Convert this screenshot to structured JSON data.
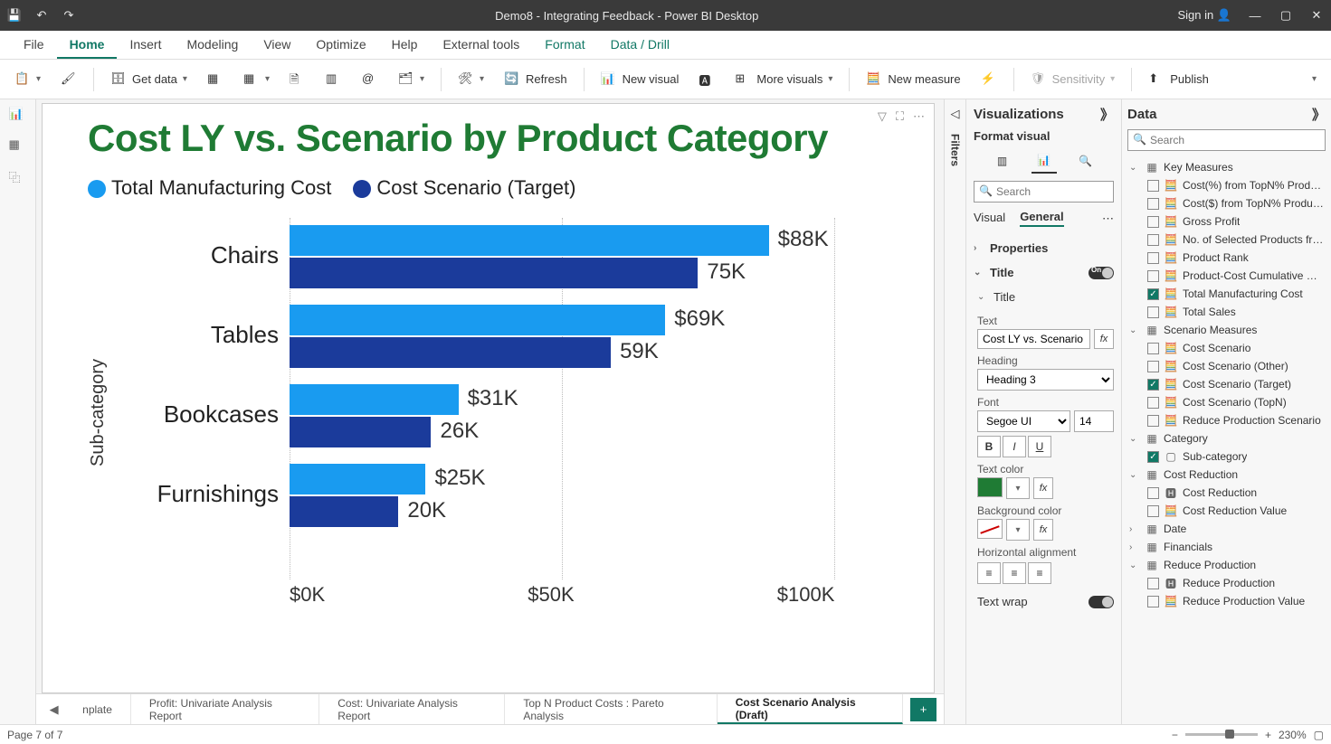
{
  "titlebar": {
    "title": "Demo8 - Integrating Feedback - Power BI Desktop",
    "signin": "Sign in"
  },
  "menu": [
    "File",
    "Home",
    "Insert",
    "Modeling",
    "View",
    "Optimize",
    "Help",
    "External tools",
    "Format",
    "Data / Drill"
  ],
  "ribbon": {
    "getdata": "Get data",
    "refresh": "Refresh",
    "newvisual": "New visual",
    "morevisuals": "More visuals",
    "newmeasure": "New measure",
    "sensitivity": "Sensitivity",
    "publish": "Publish"
  },
  "filters_label": "Filters",
  "viz": {
    "title": "Visualizations",
    "sub": "Format visual",
    "search_ph": "Search",
    "tabs": {
      "visual": "Visual",
      "general": "General"
    },
    "properties": "Properties",
    "title_section": "Title",
    "form": {
      "title": "Title",
      "text_lbl": "Text",
      "text_val": "Cost LY vs. Scenario",
      "heading_lbl": "Heading",
      "heading_val": "Heading 3",
      "font_lbl": "Font",
      "font_val": "Segoe UI",
      "font_size": "14",
      "textcolor_lbl": "Text color",
      "bgcolor_lbl": "Background color",
      "halign_lbl": "Horizontal alignment",
      "wrap_lbl": "Text wrap"
    }
  },
  "data": {
    "title": "Data",
    "search_ph": "Search",
    "tables": [
      {
        "name": "Key Measures",
        "fields": [
          {
            "n": "Cost(%) from TopN% Products",
            "c": false,
            "i": "calc"
          },
          {
            "n": "Cost($) from TopN% Products",
            "c": false,
            "i": "calc"
          },
          {
            "n": "Gross Profit",
            "c": false,
            "i": "calc"
          },
          {
            "n": "No. of Selected Products fro…",
            "c": false,
            "i": "calc"
          },
          {
            "n": "Product Rank",
            "c": false,
            "i": "calc"
          },
          {
            "n": "Product-Cost Cumulative Per…",
            "c": false,
            "i": "calc"
          },
          {
            "n": "Total Manufacturing Cost",
            "c": true,
            "i": "calc"
          },
          {
            "n": "Total Sales",
            "c": false,
            "i": "calc"
          }
        ]
      },
      {
        "name": "Scenario Measures",
        "fields": [
          {
            "n": "Cost Scenario",
            "c": false,
            "i": "calc"
          },
          {
            "n": "Cost Scenario (Other)",
            "c": false,
            "i": "calc"
          },
          {
            "n": "Cost Scenario (Target)",
            "c": true,
            "i": "calc"
          },
          {
            "n": "Cost Scenario (TopN)",
            "c": false,
            "i": "calc"
          },
          {
            "n": "Reduce Production Scenario",
            "c": false,
            "i": "calc"
          }
        ]
      },
      {
        "name": "Category",
        "fields": [
          {
            "n": "Sub-category",
            "c": true,
            "i": "col"
          }
        ]
      },
      {
        "name": "Cost Reduction",
        "fields": [
          {
            "n": "Cost Reduction",
            "c": false,
            "i": "hier"
          },
          {
            "n": "Cost Reduction Value",
            "c": false,
            "i": "calc"
          }
        ]
      },
      {
        "name": "Date",
        "collapsed": true
      },
      {
        "name": "Financials",
        "collapsed": true
      },
      {
        "name": "Reduce Production",
        "fields": [
          {
            "n": "Reduce Production",
            "c": false,
            "i": "hier"
          },
          {
            "n": "Reduce Production Value",
            "c": false,
            "i": "calc"
          }
        ]
      }
    ]
  },
  "chart_data": {
    "type": "bar",
    "title": "Cost LY vs. Scenario by Product Category",
    "ylabel": "Sub-category",
    "xlabel": "",
    "xlim": [
      0,
      110
    ],
    "xticks": [
      "$0K",
      "$50K",
      "$100K"
    ],
    "categories": [
      "Chairs",
      "Tables",
      "Bookcases",
      "Furnishings"
    ],
    "series": [
      {
        "name": "Total Manufacturing Cost",
        "color": "#199bf0",
        "values": [
          88,
          69,
          31,
          25
        ],
        "labels": [
          "$88K",
          "$69K",
          "$31K",
          "$25K"
        ]
      },
      {
        "name": "Cost Scenario (Target)",
        "color": "#1b3b9b",
        "values": [
          75,
          59,
          26,
          20
        ],
        "labels": [
          "75K",
          "59K",
          "26K",
          "20K"
        ]
      }
    ]
  },
  "tabs": {
    "items": [
      "nplate",
      "Profit: Univariate Analysis Report",
      "Cost: Univariate Analysis Report",
      "Top N Product Costs : Pareto Analysis",
      "Cost Scenario Analysis (Draft)"
    ],
    "active": 4
  },
  "status": {
    "page": "Page 7 of 7",
    "zoom": "230%"
  }
}
